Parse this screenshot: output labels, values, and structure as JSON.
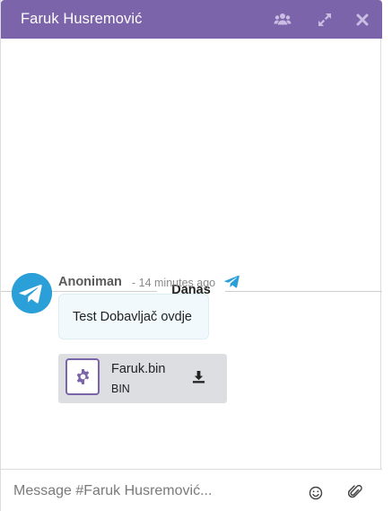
{
  "header": {
    "title": "Faruk Husremović",
    "background": "#7b64aa",
    "icons": [
      "users-icon",
      "expand-icon",
      "close-icon"
    ]
  },
  "conversation": {
    "day_separator": "Danas",
    "message": {
      "author": "Anoniman",
      "time": "- 14 minutes ago",
      "source_icon": "telegram-icon",
      "text": "Test Dobavljač ovdje",
      "avatar_color": "#2a9fd8"
    },
    "attachment": {
      "file_name": "Faruk.bin",
      "file_type": "BIN",
      "icon": "gear-icon",
      "action_icon": "download-icon"
    }
  },
  "composer": {
    "placeholder": "Message #Faruk Husremović...",
    "icons": [
      "emoji-icon",
      "paperclip-icon"
    ]
  }
}
